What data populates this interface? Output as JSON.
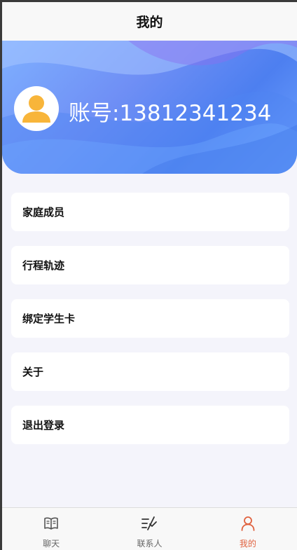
{
  "nav": {
    "title": "我的"
  },
  "profile": {
    "account": "账号:13812341234"
  },
  "menu": {
    "items": [
      {
        "label": "家庭成员"
      },
      {
        "label": "行程轨迹"
      },
      {
        "label": "绑定学生卡"
      },
      {
        "label": "关于"
      },
      {
        "label": "退出登录"
      }
    ]
  },
  "tabbar": {
    "items": [
      {
        "label": "聊天",
        "icon": "book-icon"
      },
      {
        "label": "联系人",
        "icon": "contacts-icon"
      },
      {
        "label": "我的",
        "icon": "user-icon",
        "active": true
      }
    ]
  },
  "colors": {
    "accent": "#e0623f",
    "avatar": "#f8b53a",
    "banner_start": "#7fb0ff",
    "banner_end": "#4d7ff0"
  }
}
